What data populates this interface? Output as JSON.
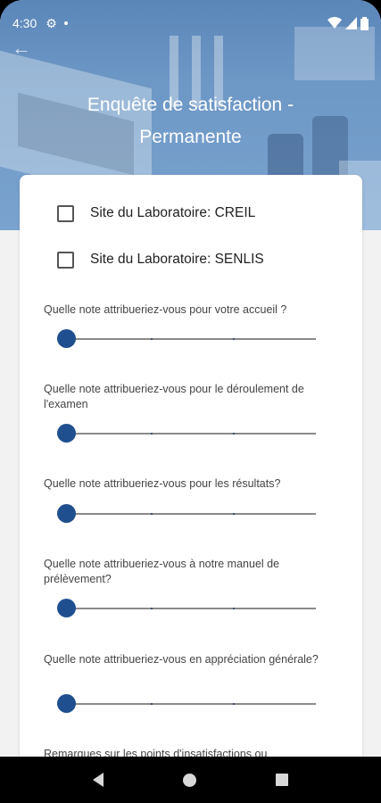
{
  "status_bar": {
    "time": "4:30"
  },
  "header": {
    "title": "Enquête de satisfaction - Permanente"
  },
  "sites": [
    {
      "label": "Site du Laboratoire: CREIL"
    },
    {
      "label": "Site du Laboratoire: SENLIS"
    }
  ],
  "questions": [
    {
      "text": "Quelle note attribueriez-vous pour votre accueil ?",
      "rating": 0
    },
    {
      "text": "Quelle note attribueriez-vous pour le déroulement de l'examen",
      "rating": 0
    },
    {
      "text": "Quelle note attribueriez-vous pour les résultats?",
      "rating": 0
    },
    {
      "text": "Quelle note attribueriez-vous à notre manuel de prélèvement?",
      "rating": 0
    },
    {
      "text": "Quelle note attribueriez-vous en appréciation générale?",
      "rating": 0
    }
  ],
  "remarks_label": "Remarques sur les points d'insatisfactions ou",
  "colors": {
    "accent": "#1f4f8f",
    "header": "#6d97c5"
  }
}
